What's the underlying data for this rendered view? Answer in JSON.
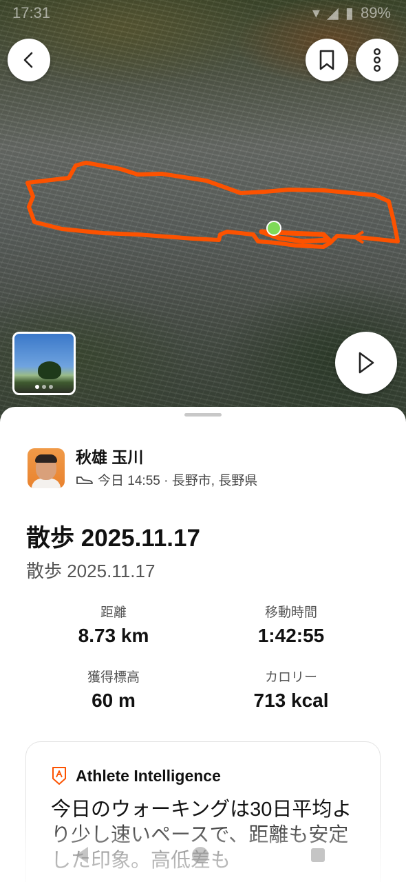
{
  "status_bar": {
    "time": "17:31",
    "battery": "89%"
  },
  "map": {
    "route_color": "#fc5200",
    "start_marker_color": "#7ed957"
  },
  "photo": {
    "page_count": 3,
    "active_index": 0
  },
  "athlete": {
    "name": "秋雄 玉川",
    "meta": "今日 14:55 · 長野市, 長野県"
  },
  "activity": {
    "title": "散歩 2025.11.17",
    "subtitle": "散歩 2025.11.17"
  },
  "stats": [
    {
      "label": "距離",
      "value": "8.73 km"
    },
    {
      "label": "移動時間",
      "value": "1:42:55"
    },
    {
      "label": "獲得標高",
      "value": "60 m"
    },
    {
      "label": "カロリー",
      "value": "713 kcal"
    }
  ],
  "athlete_intelligence": {
    "title": "Athlete Intelligence",
    "body": "今日のウォーキングは30日平均より少し速いペースで、距離も安定した印象。高低差も"
  },
  "colors": {
    "brand": "#fc5200"
  }
}
